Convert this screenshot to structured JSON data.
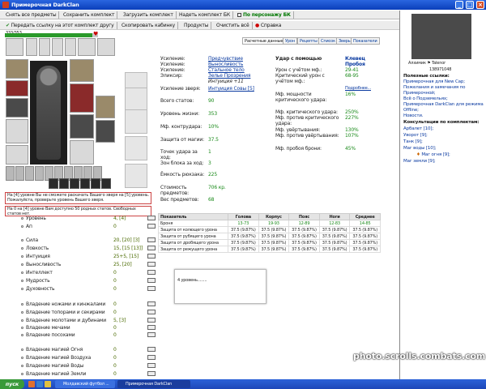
{
  "window": {
    "title": "Примерочная DarkClan",
    "min": "_",
    "max": "□",
    "close": "×"
  },
  "toolbar1": [
    {
      "label": "Снять все предметы"
    },
    {
      "label": "Сохранить комплект"
    },
    {
      "label": "Загрузить комплект"
    },
    {
      "label": "Надеть комплект БК"
    },
    {
      "label": "По персонажу БК"
    }
  ],
  "toolbar2": [
    {
      "label": "Передать ссылку на этот комплект другу"
    },
    {
      "label": "Скопировать кабинку"
    },
    {
      "label": "Продукты"
    },
    {
      "label": "Очистить всё"
    },
    {
      "label": "Справка"
    }
  ],
  "hp": {
    "text": "333/353",
    "fraction": 0.943
  },
  "warnings": [
    "На [4] уровне Вы не сможете раскачать Вашего зверя на [5] уровень. Пожалуйста, проверьте уровень Вашего зверя.",
    "На 0 на [4] уровне Вам доступно 50 родных статов. Свободных статов нет."
  ],
  "tabs": [
    "Расчетные данные",
    "Урон",
    "Рецепты",
    "Список",
    "Зверь",
    "Показатели"
  ],
  "stats_top": [
    {
      "label": "Уровень",
      "value": "4, [4]"
    },
    {
      "label": "Ап",
      "value": "0"
    }
  ],
  "stats_main": [
    {
      "label": "Сила",
      "value": "20, [20] [3]"
    },
    {
      "label": "Ловкость",
      "value": "15, [15 [13]]"
    },
    {
      "label": "Интуиция",
      "value": "25+5, [15]"
    },
    {
      "label": "Выносливость",
      "value": "25, [20]"
    },
    {
      "label": "Интеллект",
      "value": "0"
    },
    {
      "label": "Мудрость",
      "value": "0"
    },
    {
      "label": "Духовность",
      "value": "0"
    }
  ],
  "skills_weapons": [
    {
      "label": "Владение ножами и кинжалами",
      "value": "0"
    },
    {
      "label": "Владение топорами и секирами",
      "value": "0"
    },
    {
      "label": "Владение молотами и дубинами",
      "value": "5, [3]"
    },
    {
      "label": "Владение мечами",
      "value": "0"
    },
    {
      "label": "Владение посохами",
      "value": "0"
    }
  ],
  "skills_magic": [
    {
      "label": "Владение магией Огня",
      "value": "0"
    },
    {
      "label": "Владение магией Воздуха",
      "value": "0"
    },
    {
      "label": "Владение магией Воды",
      "value": "0"
    },
    {
      "label": "Владение магией Земли",
      "value": "0"
    }
  ],
  "details": {
    "buffs": [
      {
        "label": "Усиление:",
        "value": "Предчувствие"
      },
      {
        "label": "Усиление:",
        "value": "Выносливость"
      },
      {
        "label": "Усиление:",
        "value": "Стальное тело"
      },
      {
        "label": "Эликсир:",
        "value": "Зелье Прозрения"
      },
      {
        "label": "",
        "value": "Интуиция +11"
      }
    ],
    "pet": {
      "label": "Усиление зверя:",
      "value": "Интуиция Совы [5]"
    },
    "rows": [
      {
        "label": "Всего статов:",
        "value": "90"
      },
      {
        "label": "Уровень жизни:",
        "value": "353"
      },
      {
        "label": "Мф. контрудара:",
        "value": "10%"
      },
      {
        "label": "Защита от магии:",
        "value": "37.5"
      },
      {
        "label": "Точек удара за ход:",
        "value": "1"
      },
      {
        "label": "Зон блока за ход:",
        "value": "3"
      },
      {
        "label": "Ёмкость рюкзака:",
        "value": "225"
      },
      {
        "label": "Стоимость предметов:",
        "value": "706 кр."
      },
      {
        "label": "Вес предметов:",
        "value": "68"
      }
    ]
  },
  "damage": {
    "header": "Удар с помощью",
    "weapon": "Клевец Пробоя",
    "rows": [
      {
        "label": "Урон с учётом мф.:",
        "value": "29-41"
      },
      {
        "label": "Критический урон с учётом мф.:",
        "value": "68-95"
      }
    ],
    "more": "Подробнее...",
    "rows2": [
      {
        "label": "Мф. мощности критического удара:",
        "value": "16%"
      },
      {
        "label": "Мф. критического удара:",
        "value": "250%"
      },
      {
        "label": "Мф. против критического удара:",
        "value": "227%"
      },
      {
        "label": "Мф. увёртывания:",
        "value": "130%"
      },
      {
        "label": "Мф. против увёртывания:",
        "value": "107%"
      },
      {
        "label": "Мф. пробоя брони:",
        "value": "45%"
      }
    ]
  },
  "protection_table": {
    "headers": [
      "Показатель",
      "Голова",
      "Корпус",
      "Пояс",
      "Ноги",
      "Среднее"
    ],
    "rows": [
      [
        "Броня",
        "13-73",
        "19-93",
        "12-89",
        "12-83",
        "14-85"
      ],
      [
        "Защита от колющего урона",
        "37.5 (9.87%)",
        "37.5 (9.87%)",
        "37.5 (9.87%)",
        "37.5 (9.87%)",
        "37.5 (9.87%)"
      ],
      [
        "Защита от рубящего урона",
        "37.5 (9.87%)",
        "37.5 (9.87%)",
        "37.5 (9.87%)",
        "37.5 (9.87%)",
        "37.5 (9.87%)"
      ],
      [
        "Защита от дробящего урона",
        "37.5 (9.87%)",
        "37.5 (9.87%)",
        "37.5 (9.87%)",
        "37.5 (9.87%)",
        "37.5 (9.87%)"
      ],
      [
        "Защита от режущего урона",
        "37.5 (9.87%)",
        "37.5 (9.87%)",
        "37.5 (9.87%)",
        "37.5 (9.87%)",
        "37.5 (9.87%)"
      ]
    ]
  },
  "popup": {
    "text": "4 уровень........"
  },
  "right": {
    "user1": "Алхимик",
    "user2": "Talenor",
    "userid": "138971048",
    "useful_header": "Полезные ссылки:",
    "links": [
      "Примерочная для New Cap;",
      "Пожелания и замечания по Примерочной;",
      "Всё о Подземельях;",
      "Примерочная DarkClan для режима Offline;",
      "Новости."
    ],
    "consult_header": "Консультации по комплектам:",
    "consult": [
      "Арбалет [10];",
      "Уворот [9];",
      "Танк [9];",
      "Маг воды [10];",
      "Маг огня [9];",
      "Маг земли [9];"
    ]
  },
  "taskbar": {
    "start": "пуск",
    "tasks": [
      "Молдавский футбол ...",
      "Примерочная DarkClan"
    ]
  },
  "watermark": "photo.scrolls.combats.com",
  "colors": {
    "titlebar": "#0b3fba",
    "link": "#0a3aa0",
    "value_green": "#1a8a1a",
    "taskbar": "#2c62d8"
  }
}
